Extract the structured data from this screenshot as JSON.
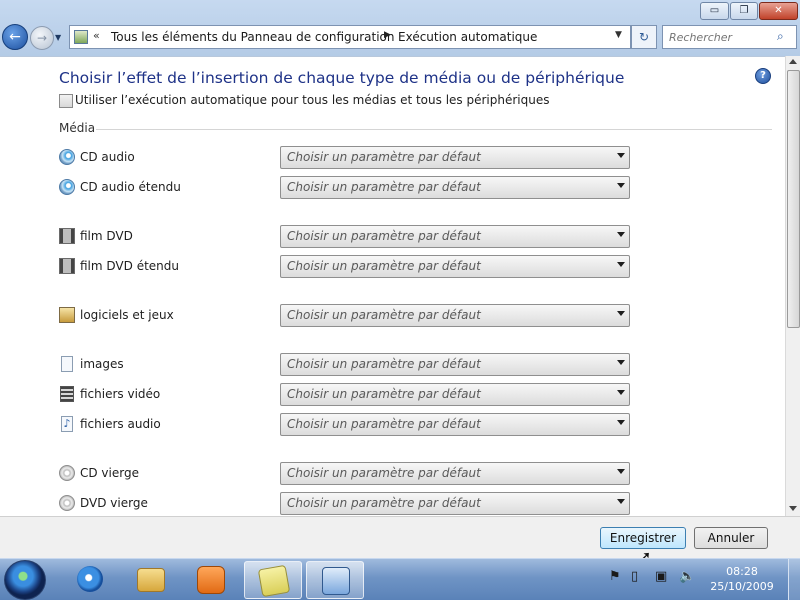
{
  "window": {
    "minimize_glyph": "▭",
    "maximize_glyph": "❐",
    "close_glyph": "✕"
  },
  "nav": {
    "back_glyph": "←",
    "forward_glyph": "→",
    "history_glyph": "▼"
  },
  "address": {
    "overflow_glyph": "«",
    "breadcrumb_root": "Tous les éléments du Panneau de configuration",
    "separator": "▶",
    "breadcrumb_current": "Exécution automatique",
    "dropdown_glyph": "▼",
    "refresh_glyph": "↻"
  },
  "search": {
    "placeholder": "Rechercher",
    "icon": "search-icon",
    "glyph": "⌕"
  },
  "help_glyph": "?",
  "content": {
    "heading": "Choisir l’effet de l’insertion de chaque type de média ou de périphérique",
    "autoplay_checkbox_label": "Utiliser l’exécution automatique pour tous les médias et tous les périphériques",
    "autoplay_checked": false,
    "section_label": "Média",
    "default_choice": "Choisir un paramètre par défaut",
    "media": [
      {
        "label": "CD audio",
        "icon": "audio-cd-icon"
      },
      {
        "label": "CD audio étendu",
        "icon": "enhanced-audio-cd-icon"
      },
      {
        "label": "film DVD",
        "icon": "dvd-movie-icon"
      },
      {
        "label": "film DVD étendu",
        "icon": "enhanced-dvd-movie-icon"
      },
      {
        "label": "logiciels et jeux",
        "icon": "software-games-icon"
      },
      {
        "label": "images",
        "icon": "pictures-icon"
      },
      {
        "label": "fichiers vidéo",
        "icon": "video-files-icon"
      },
      {
        "label": "fichiers audio",
        "icon": "audio-files-icon"
      },
      {
        "label": "CD vierge",
        "icon": "blank-cd-icon"
      },
      {
        "label": "DVD vierge",
        "icon": "blank-dvd-icon"
      }
    ]
  },
  "footer": {
    "save_label": "Enregistrer",
    "cancel_label": "Annuler"
  },
  "taskbar": {
    "apps": [
      "internet-explorer-icon",
      "windows-explorer-icon",
      "media-player-icon",
      "sticky-notes-icon",
      "control-panel-icon"
    ],
    "active_app": "control-panel-icon",
    "tray_icons": [
      "action-center-icon",
      "removable-device-icon",
      "network-icon",
      "volume-icon"
    ],
    "time": "08:28",
    "date": "25/10/2009"
  }
}
